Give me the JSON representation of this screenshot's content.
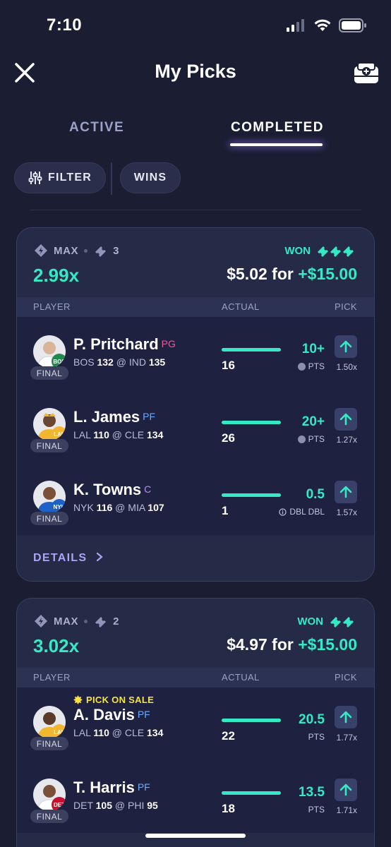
{
  "status_bar": {
    "time": "7:10"
  },
  "header": {
    "title": "My Picks"
  },
  "tabs": [
    {
      "label": "ACTIVE",
      "active": false
    },
    {
      "label": "COMPLETED",
      "active": true
    }
  ],
  "filters": {
    "filter_label": "FILTER",
    "wins_label": "WINS"
  },
  "columns": {
    "player": "PLAYER",
    "actual": "ACTUAL",
    "pick": "PICK"
  },
  "colors": {
    "accent_teal": "#35e9c4",
    "background": "#1b1d33",
    "card": "#252a47",
    "sale_yellow": "#f7e443",
    "details_purple": "#a8a6f6"
  },
  "cards": [
    {
      "max_label": "MAX",
      "entries": "3",
      "multiplier": "2.99x",
      "status": "WON",
      "payout_prefix": "$5.02 for",
      "payout_win": "+$15.00",
      "details_label": "DETAILS",
      "picks": [
        {
          "name": "P. Pritchard",
          "position": "PG",
          "position_color": "#ff4f9a",
          "team": "BOS",
          "team_score": "132",
          "at": "@",
          "opp": "IND",
          "opp_score": "135",
          "final": "FINAL",
          "actual": "16",
          "progress": 1.0,
          "line": "10+",
          "stat": "PTS",
          "stat_icon": "info-circle-icon",
          "multiplier": "1.50x",
          "jersey": "BOS",
          "jersey_color": "#1f8a4c"
        },
        {
          "name": "L. James",
          "position": "PF",
          "position_color": "#6aa8ff",
          "team": "LAL",
          "team_score": "110",
          "at": "@",
          "opp": "CLE",
          "opp_score": "134",
          "final": "FINAL",
          "actual": "26",
          "progress": 1.0,
          "line": "20+",
          "stat": "PTS",
          "stat_icon": "info-circle-icon",
          "multiplier": "1.27x",
          "jersey": "LAL",
          "jersey_color": "#f2b630"
        },
        {
          "name": "K. Towns",
          "position": "C",
          "position_color": "#b78cff",
          "team": "NYK",
          "team_score": "116",
          "at": "@",
          "opp": "MIA",
          "opp_score": "107",
          "final": "FINAL",
          "actual": "1",
          "progress": 1.0,
          "line": "0.5",
          "stat": "DBL DBL",
          "stat_icon": "info-outline-icon",
          "multiplier": "1.57x",
          "jersey": "NYK",
          "jersey_color": "#1e62c9"
        }
      ]
    },
    {
      "max_label": "MAX",
      "entries": "2",
      "multiplier": "3.02x",
      "status": "WON",
      "payout_prefix": "$4.97 for",
      "payout_win": "+$15.00",
      "picks": [
        {
          "name": "A. Davis",
          "position": "PF",
          "position_color": "#6aa8ff",
          "team": "LAL",
          "team_score": "110",
          "at": "@",
          "opp": "CLE",
          "opp_score": "134",
          "final": "FINAL",
          "actual": "22",
          "progress": 1.0,
          "line": "20.5",
          "stat": "PTS",
          "multiplier": "1.77x",
          "sale": "PICK ON SALE",
          "jersey": "LAL",
          "jersey_color": "#f2b630"
        },
        {
          "name": "T. Harris",
          "position": "PF",
          "position_color": "#6aa8ff",
          "team": "DET",
          "team_score": "105",
          "at": "@",
          "opp": "PHI",
          "opp_score": "95",
          "final": "FINAL",
          "actual": "18",
          "progress": 1.0,
          "line": "13.5",
          "stat": "PTS",
          "multiplier": "1.71x",
          "jersey": "DET",
          "jersey_color": "#c8102e"
        }
      ]
    }
  ]
}
